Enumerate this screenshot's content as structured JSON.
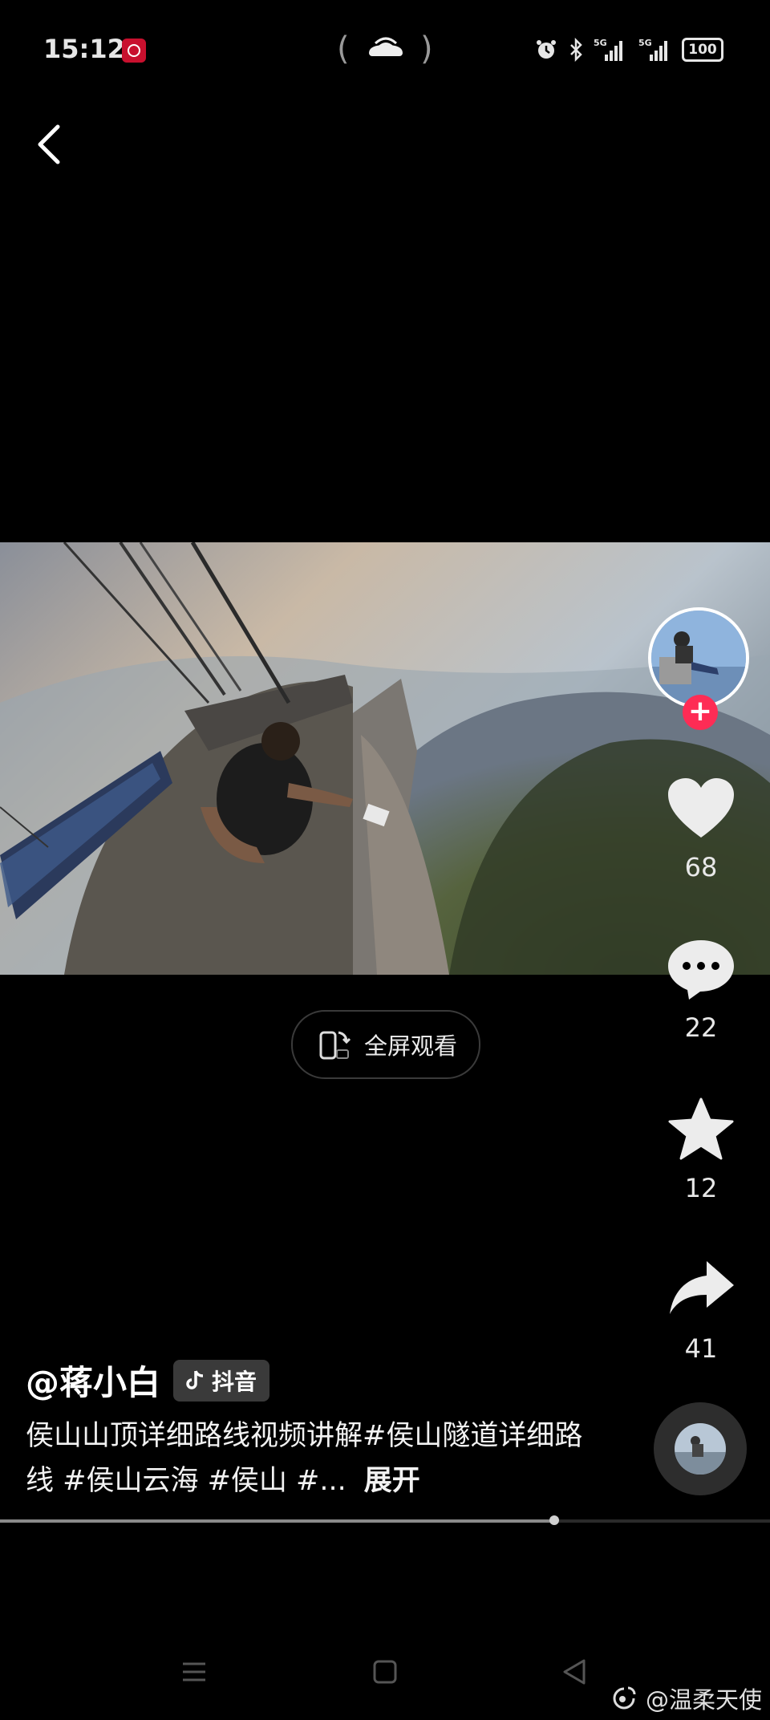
{
  "status_bar": {
    "time": "15:12",
    "battery": "100",
    "icons": [
      "bank-app-icon",
      "hotspot-icon",
      "alarm-icon",
      "bluetooth-icon",
      "signal-5g-icon",
      "signal-5g-icon"
    ]
  },
  "nav": {
    "back_icon": "chevron-left-icon"
  },
  "video": {
    "fullscreen_label": "全屏观看"
  },
  "actions": {
    "like_count": "68",
    "comment_count": "22",
    "favorite_count": "12",
    "share_count": "41"
  },
  "post": {
    "author": "@蒋小白",
    "platform_tag": "抖音",
    "description": "侯山山顶详细路线视频讲解#侯山隧道详细路线 #侯山云海 #侯山 #...",
    "expand_label": "展开"
  },
  "progress": {
    "played_fraction": 0.72
  },
  "watermark": "@温柔天使",
  "colors": {
    "background": "#000000",
    "accent_red": "#fe2c55"
  }
}
